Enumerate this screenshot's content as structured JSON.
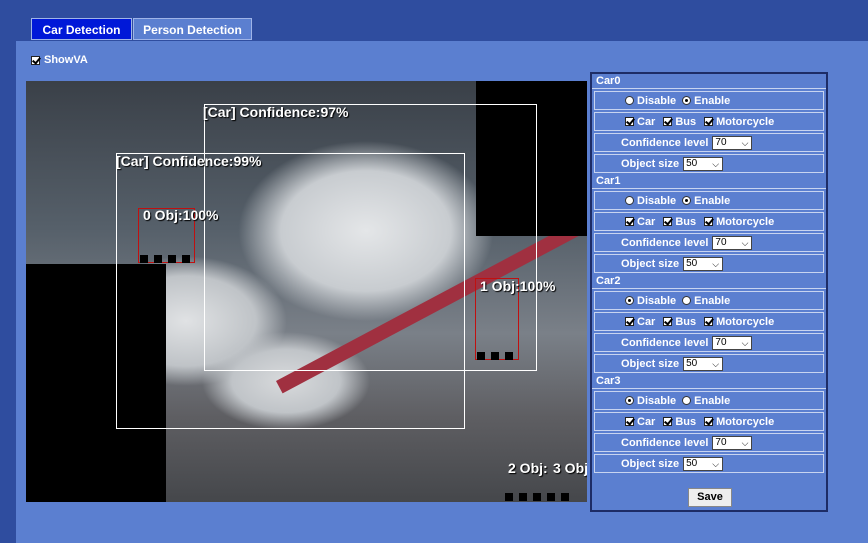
{
  "tabs": {
    "car": "Car Detection",
    "person": "Person Detection"
  },
  "showva_label": "ShowVA",
  "video": {
    "detections": [
      "[Car] Confidence:97%",
      "[Car] Confidence:99%"
    ],
    "objects": [
      "0 Obj:100%",
      "1 Obj:100%",
      "2 Obj:",
      "3 Obj:"
    ]
  },
  "panel": {
    "sections": [
      {
        "title": "Car0",
        "mode": "enable",
        "car": true,
        "bus": true,
        "motorcycle": true,
        "confidence": "70",
        "size": "50"
      },
      {
        "title": "Car1",
        "mode": "enable",
        "car": true,
        "bus": true,
        "motorcycle": true,
        "confidence": "70",
        "size": "50"
      },
      {
        "title": "Car2",
        "mode": "disable",
        "car": true,
        "bus": true,
        "motorcycle": true,
        "confidence": "70",
        "size": "50"
      },
      {
        "title": "Car3",
        "mode": "disable",
        "car": true,
        "bus": true,
        "motorcycle": true,
        "confidence": "70",
        "size": "50"
      }
    ],
    "labels": {
      "disable": "Disable",
      "enable": "Enable",
      "car": "Car",
      "bus": "Bus",
      "motorcycle": "Motorcycle",
      "confidence": "Confidence level",
      "size": "Object size"
    },
    "save": "Save"
  },
  "colors": {
    "active_tab": "#0018d8",
    "background": "#5b7fd0",
    "header": "#2f4d9f"
  }
}
